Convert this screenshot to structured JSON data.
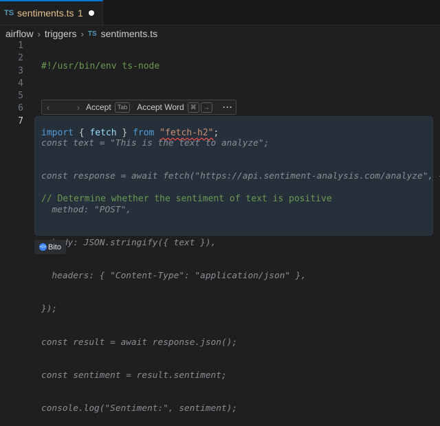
{
  "tab": {
    "lang_badge": "TS",
    "filename": "sentiments.ts",
    "problem_count": "1"
  },
  "breadcrumb": {
    "items": [
      "airflow",
      "triggers"
    ],
    "lang_badge": "TS",
    "file": "sentiments.ts"
  },
  "editor": {
    "line_numbers": [
      "1",
      "2",
      "3",
      "4",
      "5",
      "6",
      "7"
    ],
    "active_line": "7",
    "line1": "#!/usr/bin/env ts-node",
    "line3": {
      "import_kw": "import",
      "open_brace": " { ",
      "ident": "fetch",
      "close_brace": " } ",
      "from_kw": "from",
      "space": " ",
      "module": "\"fetch-h2\"",
      "semi": ";"
    },
    "line5": "// Determine whether the sentiment of text is positive"
  },
  "suggestion": {
    "lines": [
      "const text = \"This is the text to analyze\";",
      "const response = await fetch(\"https://api.sentiment-analysis.com/analyze\", {",
      "  method: \"POST\",",
      "  body: JSON.stringify({ text }),",
      "  headers: { \"Content-Type\": \"application/json\" },",
      "});",
      "const result = await response.json();",
      "const sentiment = result.sentiment;",
      "console.log(\"Sentiment:\", sentiment);"
    ]
  },
  "inline_toolbar": {
    "prev_icon": "chevron-left-icon",
    "next_icon": "chevron-right-icon",
    "accept_label": "Accept",
    "accept_key": "Tab",
    "accept_word_label": "Accept Word",
    "accept_word_key1": "⌘",
    "accept_word_key2": "→",
    "more_label": "···"
  },
  "bito": {
    "label": "Bito"
  }
}
